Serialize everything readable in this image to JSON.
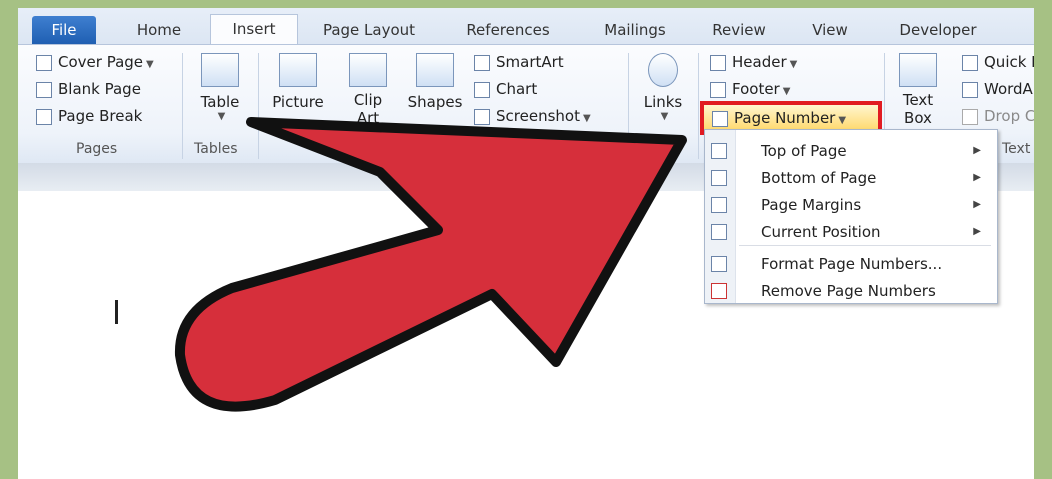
{
  "tabs": [
    "File",
    "Home",
    "Insert",
    "Page Layout",
    "References",
    "Mailings",
    "Review",
    "View",
    "Developer"
  ],
  "ribbon": {
    "pages": {
      "cover_page": "Cover Page",
      "blank_page": "Blank Page",
      "page_break": "Page Break",
      "label": "Pages"
    },
    "tables": {
      "table": "Table",
      "label": "Tables"
    },
    "illustrations": {
      "picture": "Picture",
      "clip_art_1": "Clip",
      "clip_art_2": "Art",
      "shapes": "Shapes",
      "smartart": "SmartArt",
      "chart": "Chart",
      "screenshot": "Screenshot"
    },
    "links": {
      "links": "Links"
    },
    "header_footer": {
      "header": "Header",
      "footer": "Footer",
      "page_number": "Page Number"
    },
    "text": {
      "text_box_1": "Text",
      "text_box_2": "Box",
      "quick_parts": "Quick P",
      "wordart": "WordA",
      "drop_cap": "Drop C",
      "label": "Text"
    }
  },
  "menu": {
    "items": [
      {
        "label": "Top of Page",
        "arrow": "▶"
      },
      {
        "label": "Bottom of Page",
        "arrow": "▶"
      },
      {
        "label": "Page Margins",
        "arrow": "▶"
      },
      {
        "label": "Current Position",
        "arrow": "▶"
      },
      {
        "label": "Format Page Numbers...",
        "arrow": ""
      },
      {
        "label": "Remove Page Numbers",
        "arrow": ""
      }
    ]
  },
  "colors": {
    "arrow_fill": "#d62f3b",
    "arrow_outline": "#111111",
    "highlight_border": "#e11b22",
    "file_tab": "#2a6cc4",
    "outer_border": "#a6c184"
  }
}
